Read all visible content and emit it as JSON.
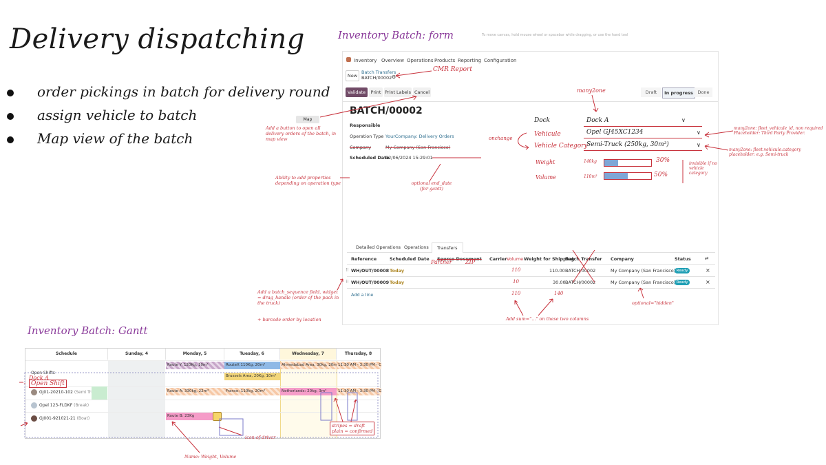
{
  "slide": {
    "title": "Delivery dispatching",
    "bullets": [
      "order pickings in batch for delivery round",
      "assign vehicle to batch",
      "Map view of the batch"
    ]
  },
  "sections": {
    "form_title": "Inventory Batch: form",
    "gantt_title": "Inventory Batch: Gantt",
    "top_hint": "To move canvas, hold mouse wheel or spacebar while dragging, or use the hand tool"
  },
  "form": {
    "app": "Inventory",
    "menu": [
      "Overview",
      "Operations",
      "Products",
      "Reporting",
      "Configuration"
    ],
    "new_label": "New",
    "breadcrumb": "Batch Transfers",
    "breadcrumb_sub": "BATCH/00002",
    "actions": [
      "Validate",
      "Print",
      "Print Labels",
      "Cancel"
    ],
    "statuses": [
      "Draft",
      "In progress",
      "Done"
    ],
    "batch_name": "BATCH/00002",
    "responsible_label": "Responsible",
    "operation_type_label": "Operation Type",
    "operation_type_value": "YourCompany: Delivery Orders",
    "company_label": "Company",
    "company_value": "My Company (San Francisco)",
    "scheduled_label": "Scheduled Date",
    "scheduled_value": "02/06/2024 15:29:01",
    "tabs": [
      "Detailed Operations",
      "Operations",
      "Transfers"
    ],
    "columns": [
      "Reference",
      "Scheduled Date",
      "Source Document",
      "Carrier",
      "Volume",
      "Weight for Shipping",
      "Batch Transfer",
      "Company",
      "Status"
    ],
    "rows": [
      {
        "ref": "WH/OUT/00008",
        "date": "Today",
        "weight": "110.00",
        "batch": "BATCH/00002",
        "company": "My Company (San Francisco)",
        "status": "Ready"
      },
      {
        "ref": "WH/OUT/00009",
        "date": "Today",
        "weight": "30.00",
        "batch": "BATCH/00002",
        "company": "My Company (San Francisco)",
        "status": "Ready"
      }
    ],
    "add_line": "Add a line"
  },
  "form_annotations": {
    "dock_label": "Dock",
    "dock_value": "Dock A",
    "vehicle_label": "Vehicule",
    "vehicle_value": "Opel GJ45XC1234",
    "category_label": "Vehicle Category",
    "category_value": "Semi-Truck (250kg, 30m³)",
    "weight_label": "Weight",
    "weight_value": "140kg",
    "weight_pct": "30%",
    "weight_fill": 0.3,
    "volume_label": "Volume",
    "volume_value": "110m³",
    "volume_pct": "50%",
    "volume_fill": 0.5,
    "cmr": "CMR Report",
    "many2one": "many2one",
    "onchange": "onchange",
    "map_btn": "Map",
    "map_note": "Add a button to open all delivery orders of the batch, in map view",
    "props_note": "Ability to add properties depending on operation type",
    "end_date_note": "optional end_date (for gantt)",
    "invisible_note": "invisible if no vehicle category",
    "m2o_vehicle_note": "many2one: fleet_vehicule_id, non required Placeholder: Third Party Provider.",
    "m2o_category_note": "many2one: fleet.vehicule.category placeholder: e.g. Semi-truck",
    "partner": "Partner",
    "zip": "ZIP",
    "vol_vals": [
      "110",
      "10",
      "110"
    ],
    "wt_total": "140",
    "sum_note": "Add sum=\"...\" on these two columns",
    "hidden_note": "optional=\"hidden\"",
    "sequence_note": "Add a batch_sequence field, widget = drag_handle (order of the pack in the truck)",
    "barcode_note": "+ barcode order by location"
  },
  "gantt": {
    "header_schedule": "Schedule",
    "days": [
      "Sunday, 4",
      "Monday, 5",
      "Tuesday, 6",
      "Wednesday, 7",
      "Thursday, 8"
    ],
    "rows": [
      {
        "name": "Open Shifts",
        "sub": ""
      },
      {
        "name": "GJ01-20210-102",
        "sub": "(Semi Truck)"
      },
      {
        "name": "Opel 123-FLDKF",
        "sub": "(Break)"
      },
      {
        "name": "GJ001-921021-21",
        "sub": "(Boat)"
      }
    ],
    "pills": [
      "Route Y: 120Kg, 10m³",
      "RouteX 110Kg, 20m³",
      "Ahmedabad Area, 30kg, 20m³",
      "11:30 AM - 3:30 PM - Cr",
      "Brussels Area, 20Kg, 10m³",
      "Route A: 330kg, 22m³",
      "France: 110kg, 20m³",
      "Netherlands: 20kg, 3m³",
      "11:30 AM - 3:30 PM - Ge",
      "Route B: 23Kg"
    ]
  },
  "gantt_annotations": {
    "dock_a": "Dock A",
    "open_shift": "Open Shift",
    "driver_note": "icon of driver",
    "stripes_note": "stripes = draft",
    "plain_note": "plain = confirmed",
    "name_note": "Name: Weight, Volume"
  }
}
